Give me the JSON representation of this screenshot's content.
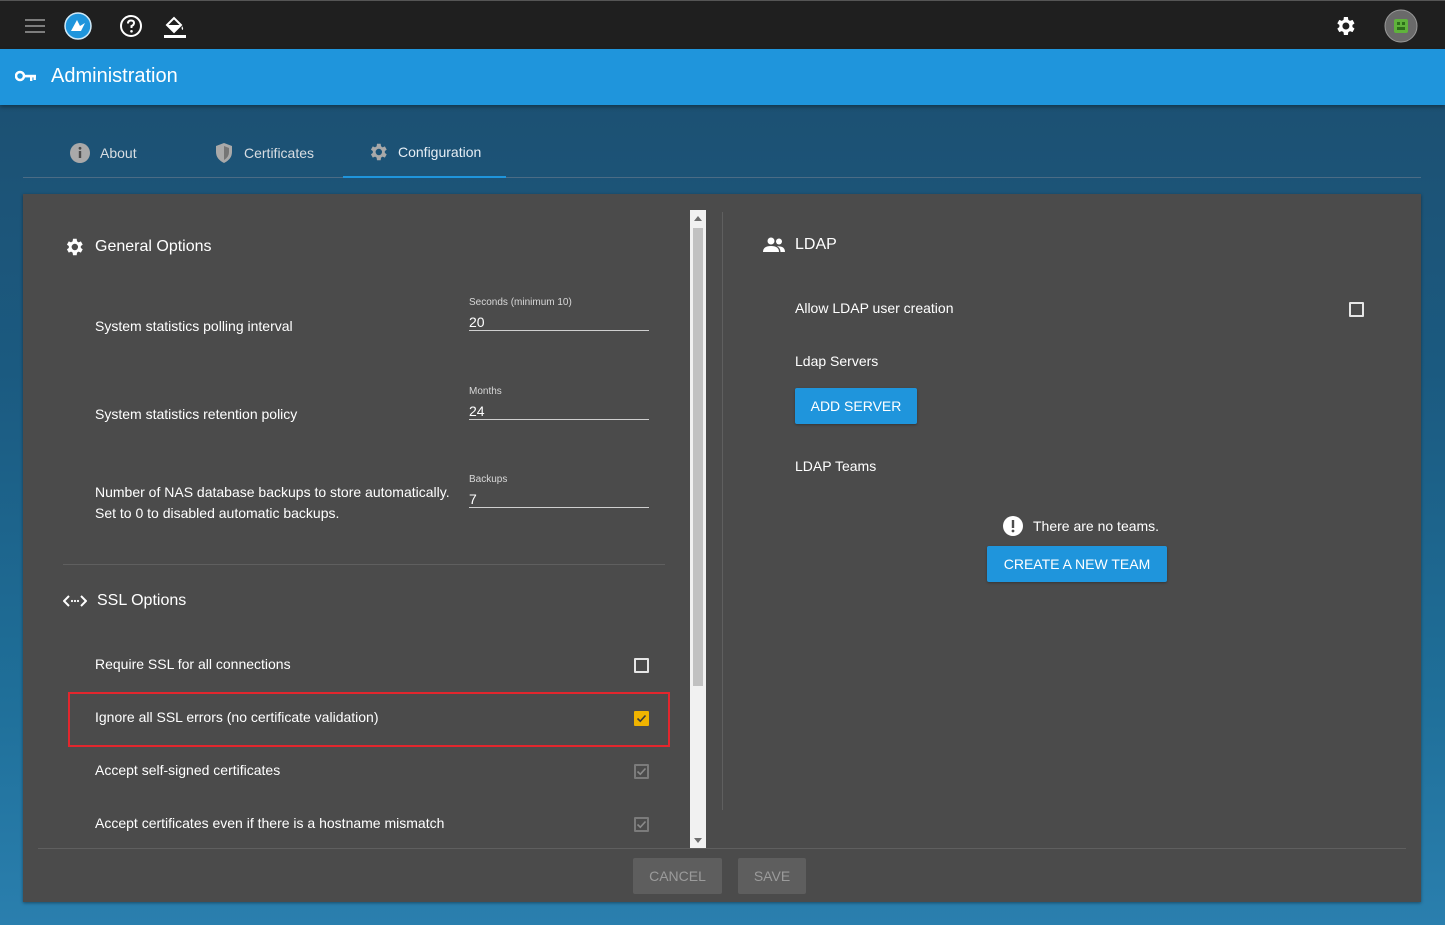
{
  "header": {
    "title": "Administration"
  },
  "tabs": [
    {
      "label": "About"
    },
    {
      "label": "Certificates"
    },
    {
      "label": "Configuration"
    }
  ],
  "general": {
    "title": "General Options",
    "polling": {
      "label": "System statistics polling interval",
      "field_label": "Seconds (minimum 10)",
      "value": "20"
    },
    "retention": {
      "label": "System statistics retention policy",
      "field_label": "Months",
      "value": "24"
    },
    "backups": {
      "label_line1": "Number of NAS database backups to store automatically.",
      "label_line2": "Set to 0 to disabled automatic backups.",
      "field_label": "Backups",
      "value": "7"
    }
  },
  "ssl": {
    "title": "SSL Options",
    "require": {
      "label": "Require SSL for all connections",
      "checked": false
    },
    "ignore": {
      "label": "Ignore all SSL errors (no certificate validation)",
      "checked": true
    },
    "self_signed": {
      "label": "Accept self-signed certificates",
      "checked": true,
      "disabled": true
    },
    "hostname": {
      "label": "Accept certificates even if there is a hostname mismatch",
      "checked": true,
      "disabled": true
    }
  },
  "ldap": {
    "title": "LDAP",
    "allow_creation": {
      "label": "Allow LDAP user creation",
      "checked": false
    },
    "servers_label": "Ldap Servers",
    "add_server": "ADD SERVER",
    "teams_label": "LDAP Teams",
    "no_teams": "There are no teams.",
    "create_team": "CREATE A NEW TEAM"
  },
  "footer": {
    "cancel": "CANCEL",
    "save": "SAVE"
  },
  "colors": {
    "accent": "#1f95dc",
    "checkbox_checked": "#f0b400",
    "highlight": "#e3262d",
    "panel": "#4b4b4b"
  }
}
